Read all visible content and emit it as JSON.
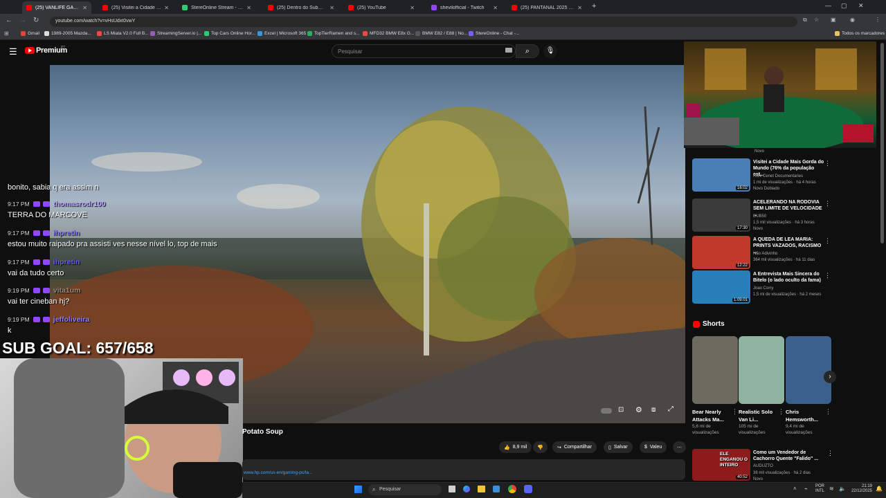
{
  "browser": {
    "tabs": [
      {
        "title": "(25) VANLIFE GAMING in th",
        "color": "#ff0000"
      },
      {
        "title": "(25) Visitei a Cidade Mais Gord",
        "color": "#ff0000"
      },
      {
        "title": "StereOnline Stream - Watch Li",
        "color": "#2ecc71"
      },
      {
        "title": "(25) Dentro do Submundo Ileg",
        "color": "#ff0000"
      },
      {
        "title": "(25) YouTube",
        "color": "#ff0000"
      },
      {
        "title": "shevilofficial - Twitch",
        "color": "#9147ff"
      },
      {
        "title": "(25) PANTANAL 2025 - Chapec",
        "color": "#ff0000"
      }
    ],
    "new_tab": "+",
    "url": "youtube.com/watch?v=vHsUdxt0vwY",
    "bookmarks": [
      "Gmail",
      "1989-2005 Mazda...",
      "LS Miata V2.0 Full B...",
      "StreamingServer.io |...",
      "Top Cars Online Hor...",
      "Excel | Microsoft 365",
      "TopTierRamen and s...",
      "MFD32 BMW E8x G...",
      "BMW E82 / E88 | No...",
      "StereOnline - Chat -..."
    ],
    "bookmarks_all": "Todos os marcadores"
  },
  "youtube": {
    "logo": "Premium",
    "logo_sup": "PT",
    "search_placeholder": "Pesquisar",
    "video_title_fragment": "Potato Soup",
    "link_text": "www.hp.com/us-en/gaming-pc/la...",
    "actions": {
      "likes": "8,9 mil",
      "share": "Compartilhar",
      "save": "Salvar",
      "thanks": "Valeu"
    },
    "sidebar_top_label": "Novo",
    "sidebar": [
      {
        "title": "Visitei a Cidade Mais Gorda do Mundo (76% da população est...",
        "channel": "Ruhi Cenet Documentaries",
        "meta": "1 mi de visualizações · há 4 horas",
        "tags": "Novo  Dublado",
        "duration": "16:02",
        "color": "#4a7fb5"
      },
      {
        "title": "ACELERANDO NA RODOVIA SEM LIMITE DE VELOCIDADE ...",
        "channel": "DUB50",
        "meta": "1,5 mil visualizações · há 3 horas",
        "tags": "Novo",
        "duration": "17:30",
        "color": "#3b3b3b"
      },
      {
        "title": "A QUEDA DE LEA MARIA: PRINTS VAZADOS, RACISMO ...",
        "channel": "Não Adivinho",
        "meta": "364 mil visualizações · há 11 dias",
        "tags": "",
        "duration": "12:22",
        "color": "#c0392b"
      },
      {
        "title": "A Entrevista Mais Sincera do Bitelo (o lado oculto da fama)",
        "channel": "Joao Corry",
        "meta": "1,5 mi de visualizações · há 2 meses",
        "tags": "",
        "duration": "1:09:01",
        "color": "#2980b9"
      }
    ],
    "shorts_label": "Shorts",
    "shorts": [
      {
        "title": "Bear Nearly Attacks Ma...",
        "views": "5,6 mi de visualizações",
        "color": "#6d6a60"
      },
      {
        "title": "Realistic Solo Van Li...",
        "views": "105 mi de visualizações",
        "color": "#8fb3a0"
      },
      {
        "title": "Chris Hemsworth...",
        "views": "9,4 mi de visualizações",
        "color": "#3a5f8a"
      }
    ],
    "bottom_video": {
      "title": "Como um Vendedor de Cachorro Quente \"Falido\" ...",
      "channel": "AUDUZTO",
      "meta": "38 mil visualizações · há 2 dias",
      "tags": "Novo",
      "duration": "40:52",
      "thumb_text": "ELE ENGANOU O INTEIRO",
      "color": "#8e1b1b"
    }
  },
  "stream": {
    "chat": [
      {
        "time": "",
        "user": "",
        "msg": "bonito, sabia q era assim n",
        "ucolor": "#ffffff"
      },
      {
        "time": "9:17 PM",
        "user": "thomasrodr100",
        "msg": "TERRA DO MARCOVE",
        "ucolor": "#b6a4ff"
      },
      {
        "time": "9:17 PM",
        "user": "ihpretin",
        "msg": "estou muito raipado pra assisti ves nesse nível lo, top de mais",
        "ucolor": "#8a7dff"
      },
      {
        "time": "9:17 PM",
        "user": "ihpretin",
        "msg": "vai da tudo certo",
        "ucolor": "#6a5cff"
      },
      {
        "time": "9:19 PM",
        "user": "vita1um",
        "msg": "vai ter cineban hj?",
        "ucolor": "#9b8a7a"
      },
      {
        "time": "9:19 PM",
        "user": "jeffoliveira",
        "msg": "k",
        "ucolor": "#8d7fff"
      }
    ],
    "sub_goal": "SUB GOAL: 657/658"
  },
  "taskbar": {
    "search": "Pesquisar",
    "lang": "POR",
    "layout": "INTL",
    "time": "21:19",
    "date": "22/12/2025"
  }
}
